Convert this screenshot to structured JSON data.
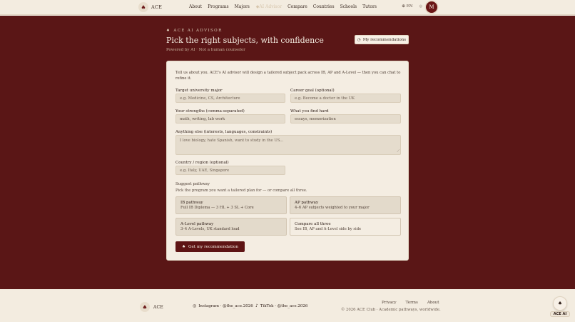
{
  "nav": {
    "brand": "ACE",
    "links": [
      "About",
      "Programs",
      "Majors"
    ],
    "faded_link": "AI Advisor",
    "links_right": [
      "Compare",
      "Countries",
      "Schools",
      "Tutors"
    ],
    "language": "EN",
    "avatar_initial": "M"
  },
  "hero": {
    "eyebrow": "ACE AI ADVISOR",
    "title": "Pick the right subjects, with confidence",
    "subtitle": "Powered by AI · Not a human counselor",
    "recommendations_button": "My recommendations"
  },
  "form": {
    "intro": "Tell us about you. ACE's AI advisor will design a tailored subject pack across IB, AP and A-Level — then you can chat to refine it.",
    "major_label": "Target university major",
    "major_placeholder": "e.g. Medicine, CS, Architecture",
    "goal_label": "Career goal (optional)",
    "goal_placeholder": "e.g. Become a doctor in the UK",
    "strengths_label": "Your strengths (comma-separated)",
    "strengths_placeholder": "math, writing, lab work",
    "hard_label": "What you find hard",
    "hard_placeholder": "essays, memorization",
    "else_label": "Anything else (interests, languages, constraints)",
    "else_placeholder": "I love biology, hate Spanish, want to study in the US...",
    "country_label": "Country / region (optional)",
    "country_placeholder": "e.g. Italy, UAE, Singapore",
    "pathway_title": "Suggest pathway",
    "pathway_help": "Pick the program you want a tailored plan for — or compare all three.",
    "pathways": [
      {
        "title": "IB pathway",
        "desc": "Full IB Diploma — 3 HL + 3 SL + Core"
      },
      {
        "title": "AP pathway",
        "desc": "4–6 AP subjects weighted to your major"
      },
      {
        "title": "A-Level pathway",
        "desc": "3–4 A-Levels, UK standard load"
      },
      {
        "title": "Compare all three",
        "desc": "See IB, AP and A-Level side by side"
      }
    ],
    "submit": "Get my recommendation"
  },
  "footer": {
    "brand": "ACE",
    "instagram": "Instagram · @the_ace.2026",
    "tiktok": "TikTok · @the_ace.2026",
    "links": [
      "Privacy",
      "Terms",
      "About"
    ],
    "copyright": "© 2026 ACE Club · Academic pathways, worldwide.",
    "assistant_label": "ACE AI"
  }
}
